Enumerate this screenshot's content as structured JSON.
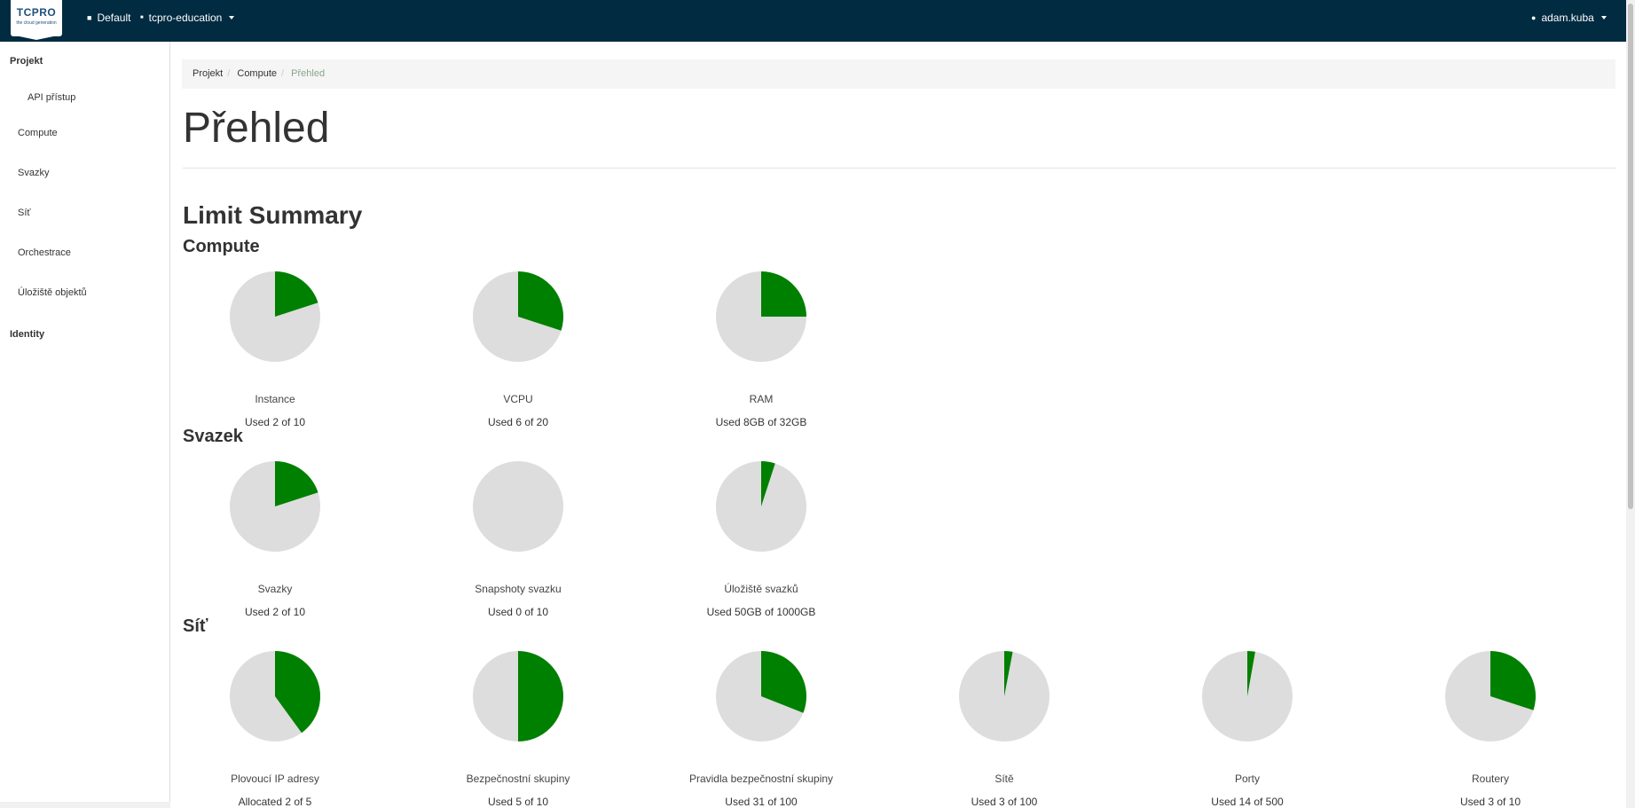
{
  "header": {
    "logo_text": "TCPRO",
    "logo_tagline": "the cloud generation",
    "domain": "Default",
    "project": "tcpro-education",
    "user": "adam.kuba"
  },
  "sidebar": {
    "projekt": "Projekt",
    "api": "API přístup",
    "compute": "Compute",
    "svazky": "Svazky",
    "sit": "Síť",
    "orchestrace": "Orchestrace",
    "uloziste": "Úložiště objektů",
    "identity": "Identity"
  },
  "breadcrumb": {
    "b1": "Projekt",
    "b2": "Compute",
    "b3": "Přehled"
  },
  "page": {
    "title": "Přehled",
    "limit_summary": "Limit Summary"
  },
  "sections": [
    {
      "title": "Compute",
      "charts": [
        {
          "label": "Instance",
          "used_text": "Used 2 of 10",
          "fraction": 0.2
        },
        {
          "label": "VCPU",
          "used_text": "Used 6 of 20",
          "fraction": 0.3
        },
        {
          "label": "RAM",
          "used_text": "Used 8GB of 32GB",
          "fraction": 0.25
        }
      ]
    },
    {
      "title": "Svazek",
      "charts": [
        {
          "label": "Svazky",
          "used_text": "Used 2 of 10",
          "fraction": 0.2
        },
        {
          "label": "Snapshoty svazku",
          "used_text": "Used 0 of 10",
          "fraction": 0.0
        },
        {
          "label": "Úložiště svazků",
          "used_text": "Used 50GB of 1000GB",
          "fraction": 0.05
        }
      ]
    },
    {
      "title": "Síť",
      "charts": [
        {
          "label": "Plovoucí IP adresy",
          "used_text": "Allocated 2 of 5",
          "fraction": 0.4
        },
        {
          "label": "Bezpečnostní skupiny",
          "used_text": "Used 5 of 10",
          "fraction": 0.5
        },
        {
          "label": "Pravidla bezpečnostní skupiny",
          "used_text": "Used 31 of 100",
          "fraction": 0.31
        },
        {
          "label": "Sítě",
          "used_text": "Used 3 of 100",
          "fraction": 0.03
        },
        {
          "label": "Porty",
          "used_text": "Used 14 of 500",
          "fraction": 0.028
        },
        {
          "label": "Routery",
          "used_text": "Used 3 of 10",
          "fraction": 0.3
        }
      ]
    }
  ],
  "colors": {
    "used": "#008000",
    "free": "#dddddd",
    "topbar": "#002b40"
  }
}
